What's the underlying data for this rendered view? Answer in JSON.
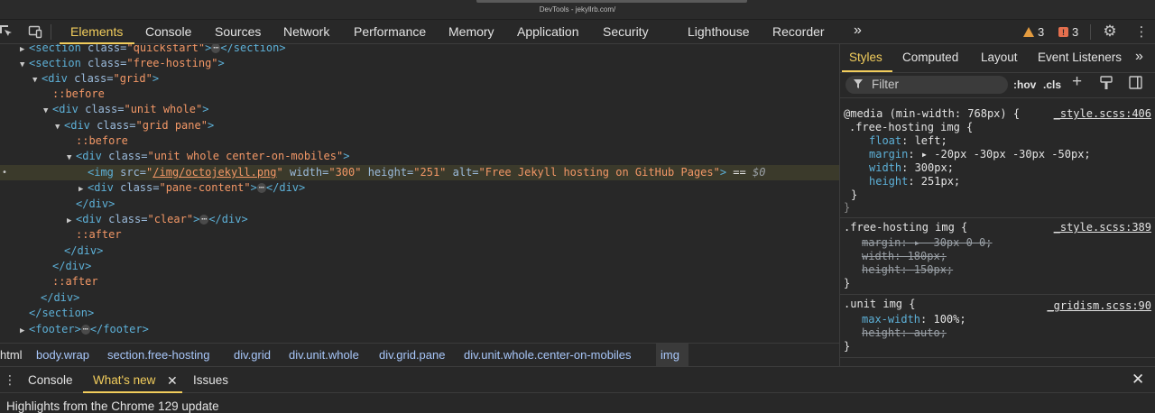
{
  "window": {
    "title": "DevTools - jekyllrb.com/"
  },
  "toolbar": {
    "tabs": [
      "Elements",
      "Console",
      "Sources",
      "Network",
      "Performance",
      "Memory",
      "Application",
      "Security",
      "Lighthouse",
      "Recorder"
    ],
    "more_glyph": "»",
    "warnings": "3",
    "errors": "3",
    "accent": "#f2cd5c"
  },
  "dom": {
    "l0": {
      "tag": "<section ",
      "attr": "class=",
      "val": "\"quickstart\"",
      "close": ">",
      "end": "</section>"
    },
    "l1": {
      "tag": "<section ",
      "attr": "class=",
      "val": "\"free-hosting\"",
      "close": ">"
    },
    "l2": {
      "tag": "<div ",
      "attr": "class=",
      "val": "\"grid\"",
      "close": ">"
    },
    "l3": {
      "pseudo": "::before"
    },
    "l4": {
      "tag": "<div ",
      "attr": "class=",
      "val": "\"unit whole\"",
      "close": ">"
    },
    "l5": {
      "tag": "<div ",
      "attr": "class=",
      "val": "\"grid pane\"",
      "close": ">"
    },
    "l6": {
      "pseudo": "::before"
    },
    "l7": {
      "tag": "<div ",
      "attr": "class=",
      "val": "\"unit whole center-on-mobiles\"",
      "close": ">"
    },
    "l8": {
      "tag": "<img ",
      "a1": "src=",
      "v1q": "\"",
      "v1": "/img/octojekyll.png",
      "v1e": "\"",
      "a2": " width=",
      "v2": "\"300\"",
      "a3": " height=",
      "v3": "\"251\"",
      "a4": " alt=",
      "v4": "\"Free Jekyll hosting on GitHub Pages\"",
      "close": ">",
      "eq": " == ",
      "dollar": "$0"
    },
    "l9": {
      "tag": "<div ",
      "attr": "class=",
      "val": "\"pane-content\"",
      "close": ">",
      "end": "</div>"
    },
    "l10": {
      "tag": "</div>"
    },
    "l11": {
      "tag": "<div ",
      "attr": "class=",
      "val": "\"clear\"",
      "close": ">",
      "end": "</div>"
    },
    "l12": {
      "pseudo": "::after"
    },
    "l13": {
      "tag": "</div>"
    },
    "l14": {
      "tag": "</div>"
    },
    "l15": {
      "pseudo": "::after"
    },
    "l16": {
      "tag": "</div>"
    },
    "l17": {
      "tag": "</section>"
    },
    "l18": {
      "tag": "<footer>",
      "end": "</footer>"
    },
    "ellipsis": "⋯",
    "selected_marker": "•"
  },
  "breadcrumb": [
    "html",
    "body.wrap",
    "section.free-hosting",
    "div.grid",
    "div.unit.whole",
    "div.grid.pane",
    "div.unit.whole.center-on-mobiles",
    "img"
  ],
  "styles_pane": {
    "tabs": [
      "Styles",
      "Computed",
      "Layout",
      "Event Listeners"
    ],
    "more_glyph": "»",
    "filter_placeholder": "Filter",
    "hov": ":hov",
    "cls": ".cls",
    "rules": [
      {
        "media": "@media (min-width: 768px) {",
        "selector": ".free-hosting img {",
        "source": "_style.scss:406",
        "props": [
          {
            "name": "float",
            "value": ": left;"
          },
          {
            "name": "margin",
            "value": ": ▸ -20px -30px -30px -50px;"
          },
          {
            "name": "width",
            "value": ": 300px;"
          },
          {
            "name": "height",
            "value": ": 251px;"
          }
        ],
        "close": "}",
        "media_close": "}"
      },
      {
        "selector": ".free-hosting img {",
        "source": "_style.scss:389",
        "props": [
          {
            "name": "margin",
            "value": ": ▸ -30px 0 0;"
          },
          {
            "name": "width",
            "value": ": 180px;"
          },
          {
            "name": "height",
            "value": ": 150px;"
          }
        ],
        "close": "}"
      },
      {
        "selector": ".unit img {",
        "source": "_gridism.scss:90",
        "props": [
          {
            "name": "max-width",
            "value": ": 100%;"
          },
          {
            "name": "height",
            "value": ": auto;"
          }
        ],
        "close": "}"
      }
    ]
  },
  "drawer": {
    "tabs": [
      "Console",
      "What's new",
      "Issues"
    ],
    "close_glyph": "✕",
    "content": "Highlights from the Chrome 129 update"
  }
}
